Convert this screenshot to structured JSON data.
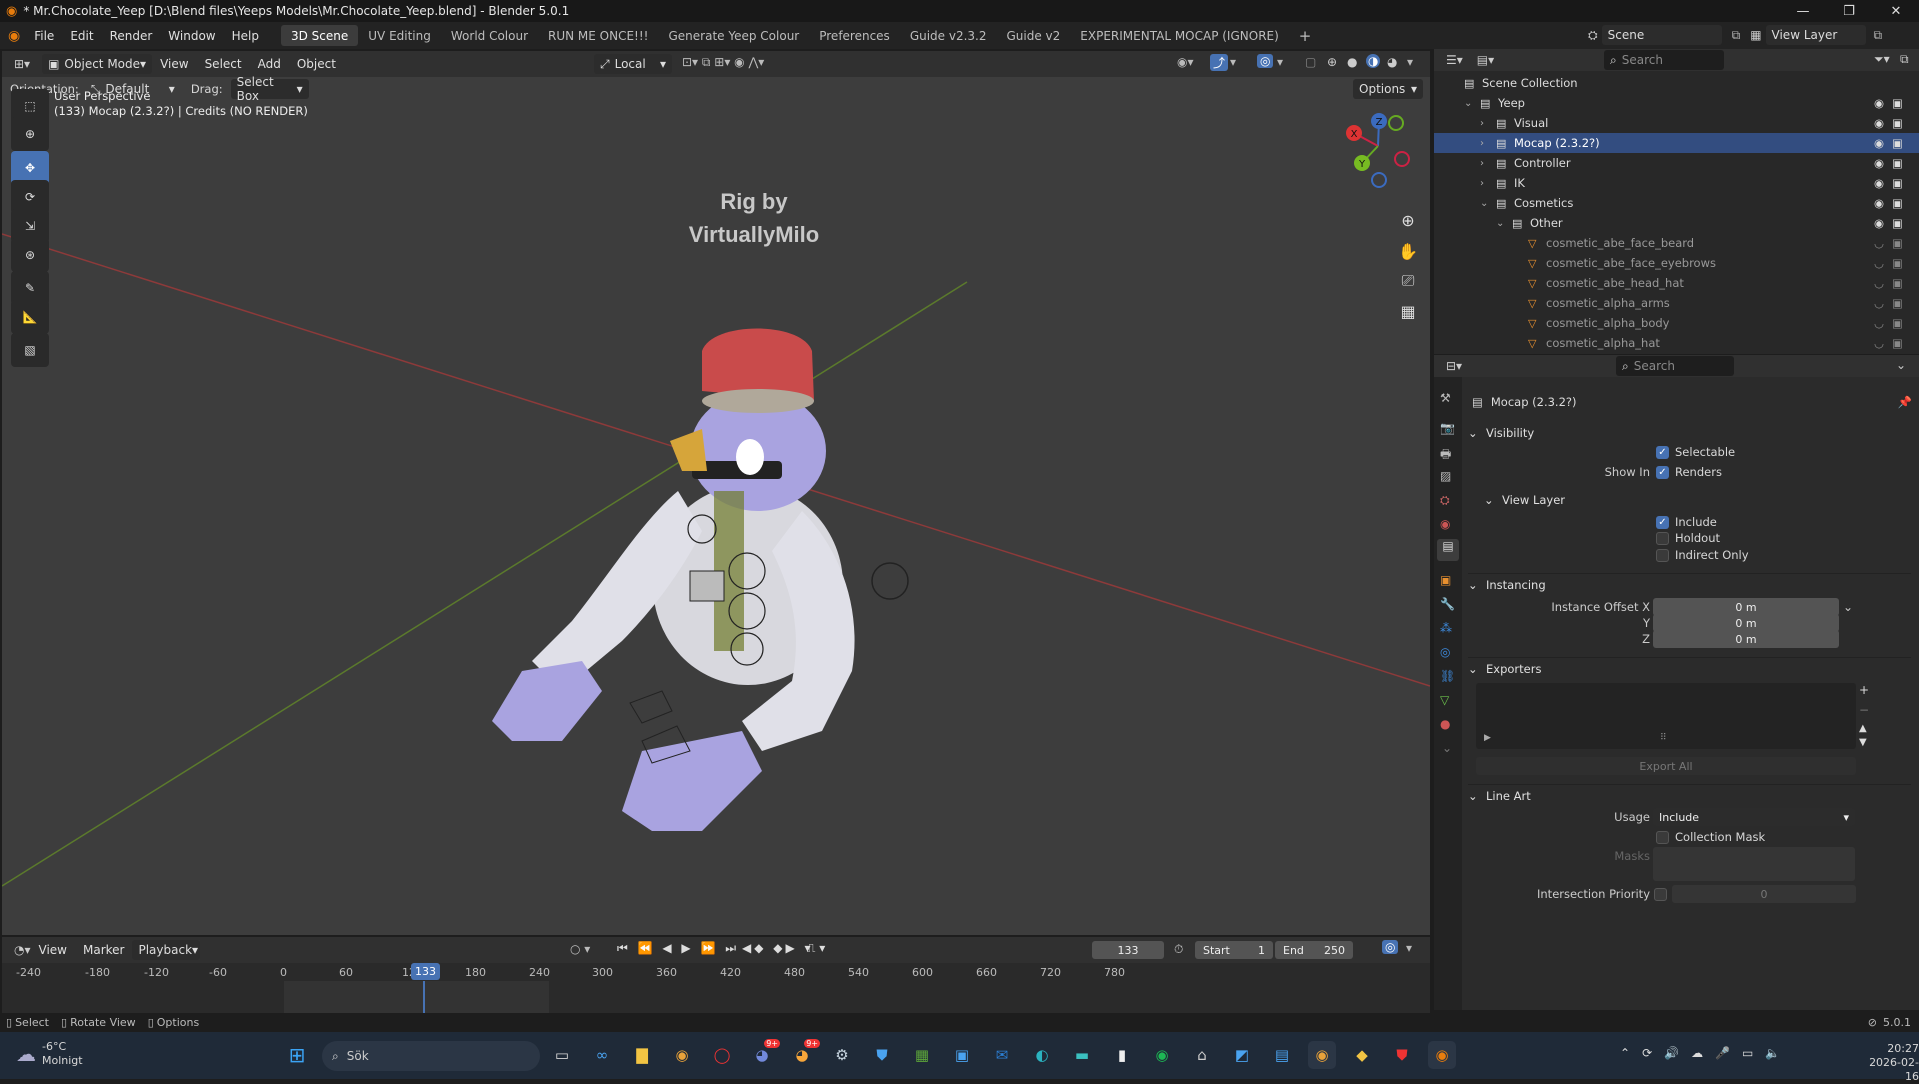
{
  "window": {
    "title": "* Mr.Chocolate_Yeep [D:\\Blend files\\Yeeps Models\\Mr.Chocolate_Yeep.blend] - Blender 5.0.1",
    "minimize": "—",
    "maximize": "❐",
    "close": "✕"
  },
  "menu": [
    "File",
    "Edit",
    "Render",
    "Window",
    "Help"
  ],
  "workspaces": [
    "3D Scene",
    "UV Editing",
    "World Colour",
    "RUN ME ONCE!!!",
    "Generate Yeep Colour",
    "Preferences",
    "Guide v2.3.2",
    "Guide v2",
    "EXPERIMENTAL MOCAP (IGNORE)"
  ],
  "add_workspace": "+",
  "scene": {
    "name": "Scene",
    "view_layer": "View Layer"
  },
  "viewport": {
    "mode": "Object Mode",
    "view": "View",
    "select": "Select",
    "add": "Add",
    "object": "Object",
    "pivot": "Local",
    "orientation_label": "Orientation:",
    "orientation": "Default",
    "drag_label": "Drag:",
    "drag": "Select Box",
    "options": "Options",
    "perspective": "User Perspective",
    "info": "(133) Mocap (2.3.2?) | Credits (NO RENDER)",
    "watermark_line1": "Rig by",
    "watermark_line2": "VirtuallyMilo",
    "gizmo": {
      "x": "X",
      "y": "Y",
      "z": "Z"
    }
  },
  "timeline": {
    "view": "View",
    "marker": "Marker",
    "playback": "Playback",
    "frame": "133",
    "start_label": "Start",
    "start": "1",
    "end_label": "End",
    "end": "250",
    "ticks": [
      "-240",
      "-180",
      "-120",
      "-60",
      "0",
      "60",
      "12",
      "133",
      "180",
      "240",
      "300",
      "360",
      "420",
      "480",
      "540",
      "600",
      "660",
      "720",
      "780"
    ]
  },
  "statusbar": {
    "select": "Select",
    "rotate": "Rotate View",
    "options": "Options",
    "version": "5.0.1"
  },
  "outliner": {
    "search": "Search",
    "items": [
      {
        "label": "Scene Collection",
        "indent": 0,
        "type": "collection"
      },
      {
        "label": "Yeep",
        "indent": 1,
        "type": "collection",
        "expanded": true
      },
      {
        "label": "Visual",
        "indent": 2,
        "type": "collection"
      },
      {
        "label": "Mocap (2.3.2?)",
        "indent": 2,
        "type": "collection",
        "selected": true
      },
      {
        "label": "Controller",
        "indent": 2,
        "type": "collection"
      },
      {
        "label": "IK",
        "indent": 2,
        "type": "collection"
      },
      {
        "label": "Cosmetics",
        "indent": 2,
        "type": "collection",
        "expanded": true
      },
      {
        "label": "Other",
        "indent": 3,
        "type": "collection",
        "expanded": true
      },
      {
        "label": "cosmetic_abe_face_beard",
        "indent": 4,
        "type": "mesh"
      },
      {
        "label": "cosmetic_abe_face_eyebrows",
        "indent": 4,
        "type": "mesh"
      },
      {
        "label": "cosmetic_abe_head_hat",
        "indent": 4,
        "type": "mesh"
      },
      {
        "label": "cosmetic_alpha_arms",
        "indent": 4,
        "type": "mesh"
      },
      {
        "label": "cosmetic_alpha_body",
        "indent": 4,
        "type": "mesh"
      },
      {
        "label": "cosmetic_alpha_hat",
        "indent": 4,
        "type": "mesh"
      }
    ]
  },
  "properties": {
    "search": "Search",
    "title": "Mocap (2.3.2?)",
    "visibility": {
      "header": "Visibility",
      "selectable": "Selectable",
      "show_in": "Show In",
      "renders": "Renders"
    },
    "view_layer": {
      "header": "View Layer",
      "include": "Include",
      "holdout": "Holdout",
      "indirect_only": "Indirect Only"
    },
    "instancing": {
      "header": "Instancing",
      "offset_x_label": "Instance Offset X",
      "y_label": "Y",
      "z_label": "Z",
      "x": "0 m",
      "y": "0 m",
      "z": "0 m"
    },
    "exporters": {
      "header": "Exporters",
      "export_all": "Export All"
    },
    "line_art": {
      "header": "Line Art",
      "usage_label": "Usage",
      "usage": "Include",
      "collection_mask": "Collection Mask",
      "masks_label": "Masks",
      "intersection_priority": "Intersection Priority",
      "priority_value": "0"
    }
  },
  "taskbar": {
    "weather_temp": "-6°C",
    "weather_desc": "Molnigt",
    "search": "Sök",
    "time": "20:27",
    "date": "2026-02-16",
    "badge1": "9+",
    "badge2": "9+"
  }
}
